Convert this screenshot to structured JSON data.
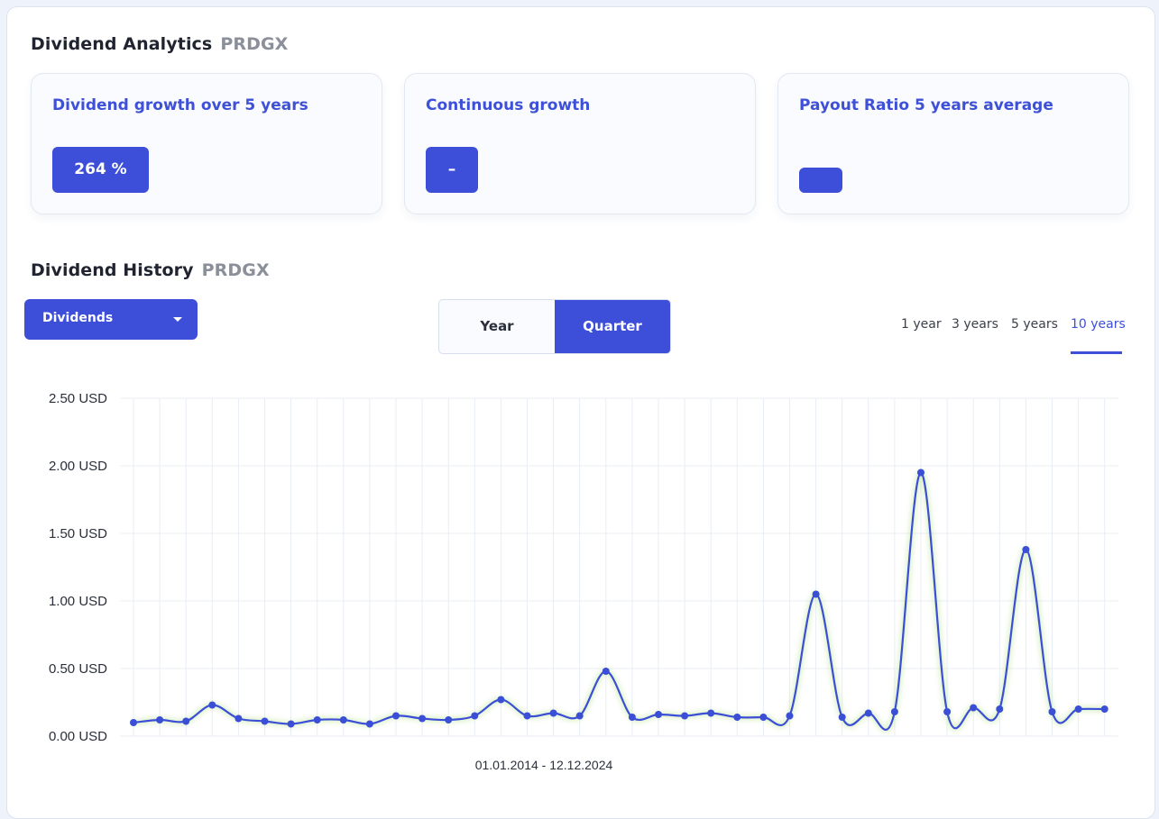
{
  "analytics": {
    "title": "Dividend Analytics",
    "ticker": "PRDGX",
    "metrics": [
      {
        "label": "Dividend growth over 5 years",
        "value": "264 %"
      },
      {
        "label": "Continuous growth",
        "value": "–"
      },
      {
        "label": "Payout Ratio 5 years average",
        "value": ""
      }
    ]
  },
  "history": {
    "title": "Dividend History",
    "ticker": "PRDGX",
    "dropdown": {
      "selected": "Dividends"
    },
    "period_toggle": {
      "options": [
        "Year",
        "Quarter"
      ],
      "selected": "Quarter"
    },
    "ranges": [
      "1 year",
      "3 years",
      "5 years",
      "10 years"
    ],
    "selected_range": "10 years"
  },
  "colors": {
    "accent": "#3d4fd8",
    "line": "#3b4fd6",
    "grid": "#e8edf6",
    "glow": "#c5e8a3"
  },
  "chart_data": {
    "type": "line",
    "date_range": "01.01.2014 - 12.12.2024",
    "ylim": [
      0,
      2.5
    ],
    "y_ticks": [
      "0.00 USD",
      "0.50 USD",
      "1.00 USD",
      "1.50 USD",
      "2.00 USD",
      "2.50 USD"
    ],
    "series": [
      {
        "values": [
          0.1,
          0.12,
          0.11,
          0.23,
          0.13,
          0.11,
          0.09,
          0.12,
          0.12,
          0.09,
          0.15,
          0.13,
          0.12,
          0.15,
          0.27,
          0.15,
          0.17,
          0.15,
          0.48,
          0.14,
          0.16,
          0.15,
          0.17,
          0.14,
          0.14,
          0.15,
          1.05,
          0.14,
          0.17,
          0.18,
          1.95,
          0.18,
          0.21,
          0.2,
          1.38,
          0.18,
          0.2,
          0.2
        ]
      }
    ]
  }
}
